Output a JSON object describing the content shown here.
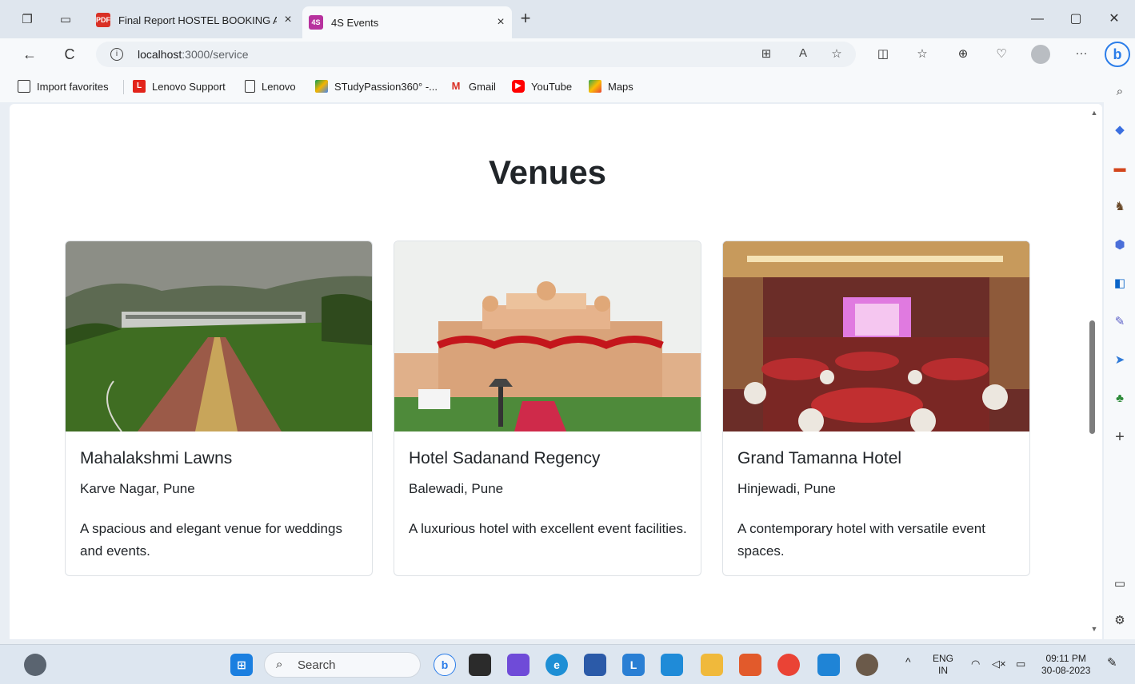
{
  "browser": {
    "tabs": [
      {
        "title": "Final Report HOSTEL BOOKING A",
        "favicon": "PDF",
        "close": "×"
      },
      {
        "title": "4S Events",
        "favicon": "4S",
        "close": "×"
      }
    ],
    "new_tab": "+",
    "window_controls": {
      "minimize": "—",
      "restore": "▢",
      "close": "✕"
    },
    "nav": {
      "back": "←",
      "refresh": "C"
    },
    "url_host": "localhost",
    "url_rest": ":3000/service",
    "favorites": [
      {
        "label": "Import favorites",
        "icon": "import-favorites-icon"
      },
      {
        "label": "Lenovo Support",
        "icon": "lenovo-support-icon"
      },
      {
        "label": "Lenovo",
        "icon": "page-icon"
      },
      {
        "label": "STudyPassion360° -...",
        "icon": "google-drive-icon"
      },
      {
        "label": "Gmail",
        "icon": "gmail-icon"
      },
      {
        "label": "YouTube",
        "icon": "youtube-icon"
      },
      {
        "label": "Maps",
        "icon": "maps-icon"
      }
    ],
    "more": "···",
    "bing": "b"
  },
  "page": {
    "heading": "Venues",
    "venues": [
      {
        "name": "Mahalakshmi Lawns",
        "location": "Karve Nagar, Pune",
        "description": "A spacious and elegant venue for weddings and events.",
        "image": "lawn-pathway-photo"
      },
      {
        "name": "Hotel Sadanand Regency",
        "location": "Balewadi, Pune",
        "description": "A luxurious hotel with excellent event facilities.",
        "image": "decorated-wedding-stage-photo"
      },
      {
        "name": "Grand Tamanna Hotel",
        "location": "Hinjewadi, Pune",
        "description": "A contemporary hotel with versatile event spaces.",
        "image": "banquet-hall-photo"
      }
    ]
  },
  "taskbar": {
    "search_placeholder": "Search",
    "lang_primary": "ENG",
    "lang_secondary": "IN",
    "time": "09:11 PM",
    "date": "30-08-2023"
  },
  "colors": {
    "accent": "#2b7de9",
    "page_bg": "#ffffff",
    "chrome_bg": "#f7f9fb",
    "card_border": "#dee2e6"
  }
}
